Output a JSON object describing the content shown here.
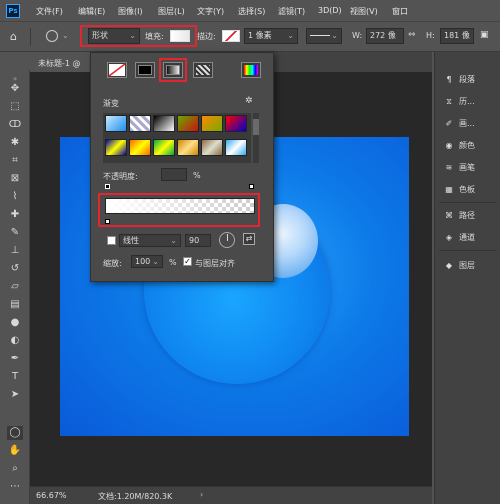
{
  "app": {
    "logo": "Ps"
  },
  "menu": [
    "文件(F)",
    "编辑(E)",
    "图像(I)",
    "图层(L)",
    "文字(Y)",
    "选择(S)",
    "滤镜(T)",
    "3D(D)",
    "视图(V)",
    "窗口"
  ],
  "options": {
    "mode": "形状",
    "fill_label": "填充:",
    "stroke_label": "描边:",
    "stroke_size": "1 像素",
    "w_label": "W:",
    "w_value": "272 像",
    "h_label": "H:",
    "h_value": "181 像"
  },
  "document": {
    "tab": "未标题-1 @",
    "zoom": "66.67%",
    "doc_info": "文档:1.20M/820.3K"
  },
  "fill_popup": {
    "section_label": "渐变",
    "opacity_label": "不透明度:",
    "opacity_unit": "%",
    "style": "线性",
    "angle": "90",
    "scale_label": "缩放:",
    "scale_value": "100",
    "scale_unit": "%",
    "align_label": "与图层对齐",
    "align_checked": true
  },
  "panels": [
    {
      "icon": "paragraph-icon",
      "label": "段落"
    },
    {
      "icon": "history-icon",
      "label": "历..."
    },
    {
      "icon": "brush-icon",
      "label": "画..."
    },
    {
      "icon": "color-icon",
      "label": "颜色"
    },
    {
      "icon": "brushes-icon",
      "label": "画笔"
    },
    {
      "icon": "swatches-icon",
      "label": "色板"
    },
    {
      "icon": "paths-icon",
      "label": "路径"
    },
    {
      "icon": "channels-icon",
      "label": "通道"
    },
    {
      "icon": "layers-icon",
      "label": "图层"
    }
  ],
  "colors": {
    "accent_red": "#e0262e",
    "canvas_blue": "#0d7ae8",
    "ps_blue": "#31a8ff"
  }
}
